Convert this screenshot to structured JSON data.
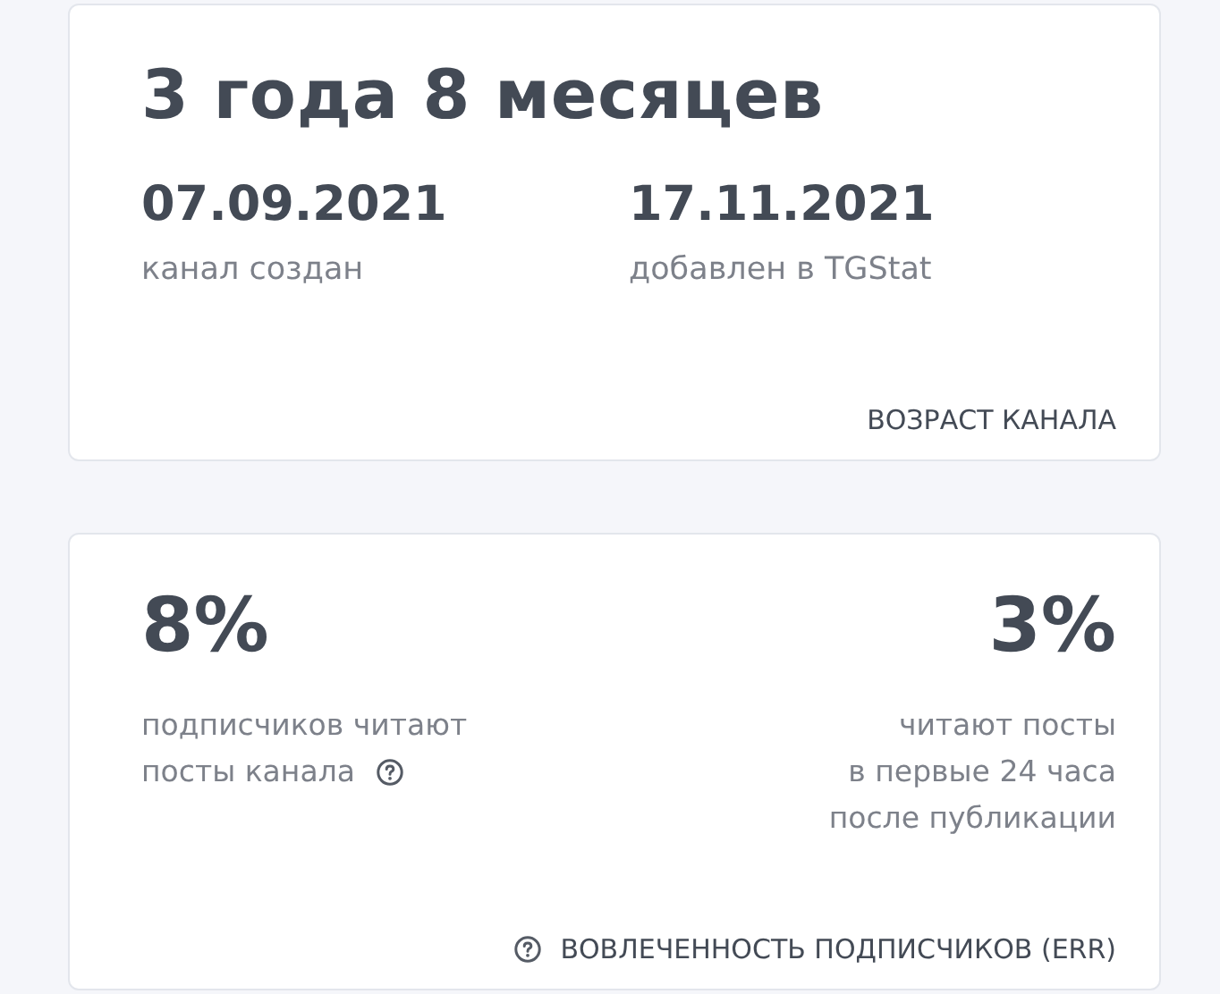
{
  "age_card": {
    "headline": "3 года 8 месяцев",
    "dates": [
      {
        "value": "07.09.2021",
        "label": "канал создан"
      },
      {
        "value": "17.11.2021",
        "label": "добавлен в TGStat"
      }
    ],
    "footer": {
      "label": "ВОЗРАСТ КАНАЛА",
      "help_icon": false
    }
  },
  "err_card": {
    "stats": [
      {
        "value": "8%",
        "lines": [
          "подписчиков читают",
          "посты канала"
        ],
        "help_icon": true
      },
      {
        "value": "3%",
        "lines": [
          "читают посты",
          "в первые 24 часа",
          "после публикации"
        ],
        "help_icon": false
      }
    ],
    "footer": {
      "label": "ВОВЛЕЧЕННОСТЬ ПОДПИСЧИКОВ (ERR)",
      "help_icon": true
    }
  }
}
